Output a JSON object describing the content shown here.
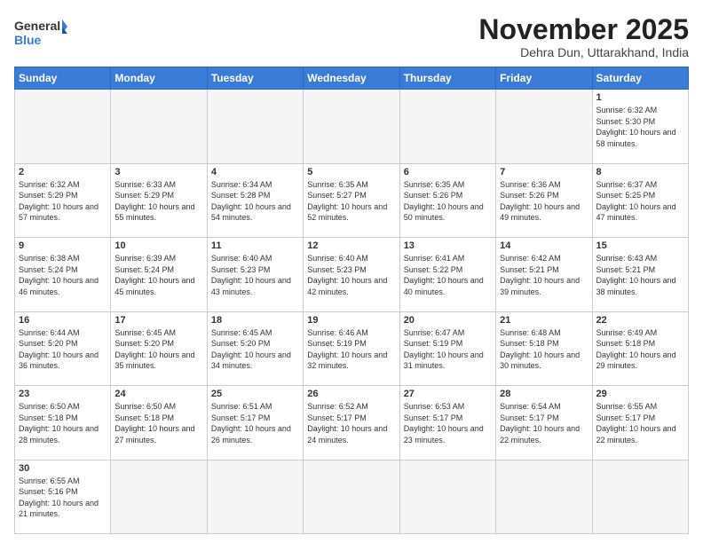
{
  "header": {
    "logo_general": "General",
    "logo_blue": "Blue",
    "month_title": "November 2025",
    "location": "Dehra Dun, Uttarakhand, India"
  },
  "days_of_week": [
    "Sunday",
    "Monday",
    "Tuesday",
    "Wednesday",
    "Thursday",
    "Friday",
    "Saturday"
  ],
  "weeks": [
    [
      {
        "num": "",
        "info": ""
      },
      {
        "num": "",
        "info": ""
      },
      {
        "num": "",
        "info": ""
      },
      {
        "num": "",
        "info": ""
      },
      {
        "num": "",
        "info": ""
      },
      {
        "num": "",
        "info": ""
      },
      {
        "num": "1",
        "info": "Sunrise: 6:32 AM\nSunset: 5:30 PM\nDaylight: 10 hours and 58 minutes."
      }
    ],
    [
      {
        "num": "2",
        "info": "Sunrise: 6:32 AM\nSunset: 5:29 PM\nDaylight: 10 hours and 57 minutes."
      },
      {
        "num": "3",
        "info": "Sunrise: 6:33 AM\nSunset: 5:29 PM\nDaylight: 10 hours and 55 minutes."
      },
      {
        "num": "4",
        "info": "Sunrise: 6:34 AM\nSunset: 5:28 PM\nDaylight: 10 hours and 54 minutes."
      },
      {
        "num": "5",
        "info": "Sunrise: 6:35 AM\nSunset: 5:27 PM\nDaylight: 10 hours and 52 minutes."
      },
      {
        "num": "6",
        "info": "Sunrise: 6:35 AM\nSunset: 5:26 PM\nDaylight: 10 hours and 50 minutes."
      },
      {
        "num": "7",
        "info": "Sunrise: 6:36 AM\nSunset: 5:26 PM\nDaylight: 10 hours and 49 minutes."
      },
      {
        "num": "8",
        "info": "Sunrise: 6:37 AM\nSunset: 5:25 PM\nDaylight: 10 hours and 47 minutes."
      }
    ],
    [
      {
        "num": "9",
        "info": "Sunrise: 6:38 AM\nSunset: 5:24 PM\nDaylight: 10 hours and 46 minutes."
      },
      {
        "num": "10",
        "info": "Sunrise: 6:39 AM\nSunset: 5:24 PM\nDaylight: 10 hours and 45 minutes."
      },
      {
        "num": "11",
        "info": "Sunrise: 6:40 AM\nSunset: 5:23 PM\nDaylight: 10 hours and 43 minutes."
      },
      {
        "num": "12",
        "info": "Sunrise: 6:40 AM\nSunset: 5:23 PM\nDaylight: 10 hours and 42 minutes."
      },
      {
        "num": "13",
        "info": "Sunrise: 6:41 AM\nSunset: 5:22 PM\nDaylight: 10 hours and 40 minutes."
      },
      {
        "num": "14",
        "info": "Sunrise: 6:42 AM\nSunset: 5:21 PM\nDaylight: 10 hours and 39 minutes."
      },
      {
        "num": "15",
        "info": "Sunrise: 6:43 AM\nSunset: 5:21 PM\nDaylight: 10 hours and 38 minutes."
      }
    ],
    [
      {
        "num": "16",
        "info": "Sunrise: 6:44 AM\nSunset: 5:20 PM\nDaylight: 10 hours and 36 minutes."
      },
      {
        "num": "17",
        "info": "Sunrise: 6:45 AM\nSunset: 5:20 PM\nDaylight: 10 hours and 35 minutes."
      },
      {
        "num": "18",
        "info": "Sunrise: 6:45 AM\nSunset: 5:20 PM\nDaylight: 10 hours and 34 minutes."
      },
      {
        "num": "19",
        "info": "Sunrise: 6:46 AM\nSunset: 5:19 PM\nDaylight: 10 hours and 32 minutes."
      },
      {
        "num": "20",
        "info": "Sunrise: 6:47 AM\nSunset: 5:19 PM\nDaylight: 10 hours and 31 minutes."
      },
      {
        "num": "21",
        "info": "Sunrise: 6:48 AM\nSunset: 5:18 PM\nDaylight: 10 hours and 30 minutes."
      },
      {
        "num": "22",
        "info": "Sunrise: 6:49 AM\nSunset: 5:18 PM\nDaylight: 10 hours and 29 minutes."
      }
    ],
    [
      {
        "num": "23",
        "info": "Sunrise: 6:50 AM\nSunset: 5:18 PM\nDaylight: 10 hours and 28 minutes."
      },
      {
        "num": "24",
        "info": "Sunrise: 6:50 AM\nSunset: 5:18 PM\nDaylight: 10 hours and 27 minutes."
      },
      {
        "num": "25",
        "info": "Sunrise: 6:51 AM\nSunset: 5:17 PM\nDaylight: 10 hours and 26 minutes."
      },
      {
        "num": "26",
        "info": "Sunrise: 6:52 AM\nSunset: 5:17 PM\nDaylight: 10 hours and 24 minutes."
      },
      {
        "num": "27",
        "info": "Sunrise: 6:53 AM\nSunset: 5:17 PM\nDaylight: 10 hours and 23 minutes."
      },
      {
        "num": "28",
        "info": "Sunrise: 6:54 AM\nSunset: 5:17 PM\nDaylight: 10 hours and 22 minutes."
      },
      {
        "num": "29",
        "info": "Sunrise: 6:55 AM\nSunset: 5:17 PM\nDaylight: 10 hours and 22 minutes."
      }
    ],
    [
      {
        "num": "30",
        "info": "Sunrise: 6:55 AM\nSunset: 5:16 PM\nDaylight: 10 hours and 21 minutes."
      },
      {
        "num": "",
        "info": ""
      },
      {
        "num": "",
        "info": ""
      },
      {
        "num": "",
        "info": ""
      },
      {
        "num": "",
        "info": ""
      },
      {
        "num": "",
        "info": ""
      },
      {
        "num": "",
        "info": ""
      }
    ]
  ]
}
